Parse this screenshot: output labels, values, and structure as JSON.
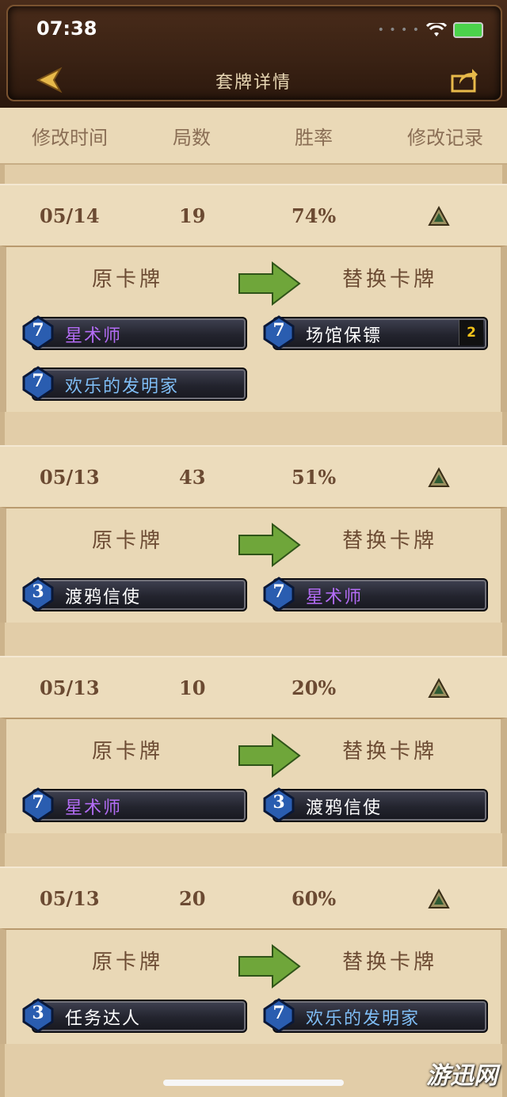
{
  "status_bar": {
    "time": "07:38"
  },
  "nav": {
    "title": "套牌详情",
    "back_icon": "back-arrow-icon",
    "share_icon": "share-icon"
  },
  "columns": {
    "modified_time": "修改时间",
    "games": "局数",
    "win_rate": "胜率",
    "change_log": "修改记录"
  },
  "labels": {
    "original": "原卡牌",
    "replacement": "替换卡牌"
  },
  "colors": {
    "legendary_text": "#b36cf4",
    "common_text": "#ffffff",
    "rare_text": "#7fbdf5",
    "arrow": "#6fa63a"
  },
  "records": [
    {
      "date": "05/14",
      "games": "19",
      "win_rate": "74%",
      "original": [
        {
          "cost": "7",
          "name": "星术师"
        },
        {
          "cost": "7",
          "name": "欢乐的发明家"
        }
      ],
      "replacement": [
        {
          "cost": "7",
          "name": "场馆保镖",
          "qty": "2"
        }
      ]
    },
    {
      "date": "05/13",
      "games": "43",
      "win_rate": "51%",
      "original": [
        {
          "cost": "3",
          "name": "渡鸦信使"
        }
      ],
      "replacement": [
        {
          "cost": "7",
          "name": "星术师"
        }
      ]
    },
    {
      "date": "05/13",
      "games": "10",
      "win_rate": "20%",
      "original": [
        {
          "cost": "7",
          "name": "星术师"
        }
      ],
      "replacement": [
        {
          "cost": "3",
          "name": "渡鸦信使"
        }
      ]
    },
    {
      "date": "05/13",
      "games": "20",
      "win_rate": "60%",
      "original": [
        {
          "cost": "3",
          "name": "任务达人"
        }
      ],
      "replacement": [
        {
          "cost": "7",
          "name": "欢乐的发明家"
        }
      ]
    }
  ],
  "watermark": "游迅网"
}
